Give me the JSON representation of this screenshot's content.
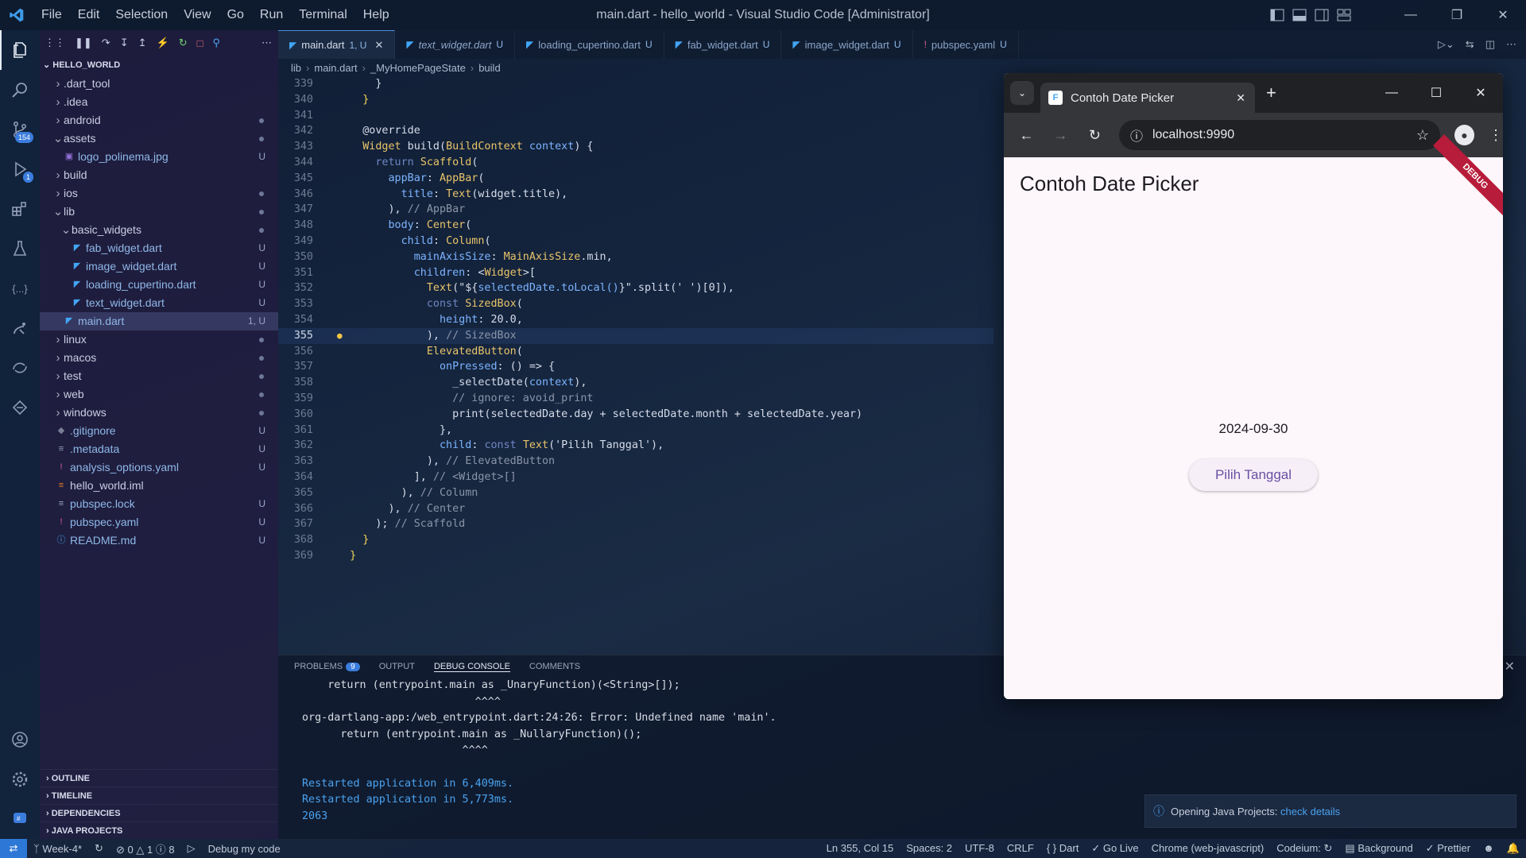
{
  "titlebar": {
    "menu": [
      "File",
      "Edit",
      "Selection",
      "View",
      "Go",
      "Run",
      "Terminal",
      "Help"
    ],
    "title": "main.dart - hello_world - Visual Studio Code [Administrator]"
  },
  "activity": {
    "scm_badge": "154",
    "debug_badge": "1"
  },
  "sidebar": {
    "header": "HELLO_WORLD",
    "tree": [
      {
        "label": ".dart_tool",
        "type": "folder",
        "depth": 0,
        "status": ""
      },
      {
        "label": ".idea",
        "type": "folder",
        "depth": 0,
        "status": ""
      },
      {
        "label": "android",
        "type": "folder",
        "depth": 0,
        "status": "dot"
      },
      {
        "label": "assets",
        "type": "folder-open",
        "depth": 0,
        "status": "dot"
      },
      {
        "label": "logo_polinema.jpg",
        "type": "image",
        "depth": 1,
        "status": "U"
      },
      {
        "label": "build",
        "type": "folder",
        "depth": 0,
        "status": ""
      },
      {
        "label": "ios",
        "type": "folder",
        "depth": 0,
        "status": "dot"
      },
      {
        "label": "lib",
        "type": "folder-open",
        "depth": 0,
        "status": "dot"
      },
      {
        "label": "basic_widgets",
        "type": "folder-open",
        "depth": 1,
        "status": "dot"
      },
      {
        "label": "fab_widget.dart",
        "type": "dart",
        "depth": 2,
        "status": "U"
      },
      {
        "label": "image_widget.dart",
        "type": "dart",
        "depth": 2,
        "status": "U"
      },
      {
        "label": "loading_cupertino.dart",
        "type": "dart",
        "depth": 2,
        "status": "U"
      },
      {
        "label": "text_widget.dart",
        "type": "dart",
        "depth": 2,
        "status": "U"
      },
      {
        "label": "main.dart",
        "type": "dart",
        "depth": 1,
        "status": "1, U",
        "selected": true
      },
      {
        "label": "linux",
        "type": "folder",
        "depth": 0,
        "status": "dot"
      },
      {
        "label": "macos",
        "type": "folder",
        "depth": 0,
        "status": "dot"
      },
      {
        "label": "test",
        "type": "folder",
        "depth": 0,
        "status": "dot"
      },
      {
        "label": "web",
        "type": "folder",
        "depth": 0,
        "status": "dot"
      },
      {
        "label": "windows",
        "type": "folder",
        "depth": 0,
        "status": "dot"
      },
      {
        "label": ".gitignore",
        "type": "git",
        "depth": 0,
        "status": "U"
      },
      {
        "label": ".metadata",
        "type": "text",
        "depth": 0,
        "status": "U"
      },
      {
        "label": "analysis_options.yaml",
        "type": "yaml",
        "depth": 0,
        "status": "U"
      },
      {
        "label": "hello_world.iml",
        "type": "xml",
        "depth": 0,
        "status": ""
      },
      {
        "label": "pubspec.lock",
        "type": "text",
        "depth": 0,
        "status": "U"
      },
      {
        "label": "pubspec.yaml",
        "type": "yaml",
        "depth": 0,
        "status": "U"
      },
      {
        "label": "README.md",
        "type": "info",
        "depth": 0,
        "status": "U"
      }
    ],
    "sections": [
      "OUTLINE",
      "TIMELINE",
      "DEPENDENCIES",
      "JAVA PROJECTS"
    ]
  },
  "tabs": [
    {
      "label": "main.dart",
      "status": "1, U",
      "active": true,
      "icon": "dart",
      "closable": true
    },
    {
      "label": "text_widget.dart",
      "status": "U",
      "active": false,
      "icon": "dart",
      "italic": true
    },
    {
      "label": "loading_cupertino.dart",
      "status": "U",
      "active": false,
      "icon": "dart"
    },
    {
      "label": "fab_widget.dart",
      "status": "U",
      "active": false,
      "icon": "dart"
    },
    {
      "label": "image_widget.dart",
      "status": "U",
      "active": false,
      "icon": "dart"
    },
    {
      "label": "pubspec.yaml",
      "status": "U",
      "active": false,
      "icon": "yaml"
    }
  ],
  "breadcrumb": [
    "lib",
    "main.dart",
    "_MyHomePageState",
    "build"
  ],
  "code": {
    "current_line": 355,
    "lines": [
      {
        "n": 339,
        "tokens": [
          {
            "t": "      }",
            "c": "#d6dcea"
          }
        ]
      },
      {
        "n": 340,
        "tokens": [
          {
            "t": "    }",
            "c": "#f2d55c"
          }
        ]
      },
      {
        "n": 341,
        "tokens": []
      },
      {
        "n": 342,
        "tokens": [
          {
            "t": "    @override",
            "c": "#d6dcea"
          }
        ]
      },
      {
        "n": 343,
        "tokens": [
          {
            "t": "    Widget",
            "c": "#e9c46a"
          },
          {
            "t": " build(",
            "c": "#d6dcea"
          },
          {
            "t": "BuildContext",
            "c": "#e9c46a"
          },
          {
            "t": " context",
            "c": "#7cb4ff"
          },
          {
            "t": ") {",
            "c": "#d6dcea"
          }
        ]
      },
      {
        "n": 344,
        "tokens": [
          {
            "t": "      return ",
            "c": "#6f86c4"
          },
          {
            "t": "Scaffold",
            "c": "#e9c46a"
          },
          {
            "t": "(",
            "c": "#d6dcea"
          }
        ]
      },
      {
        "n": 345,
        "tokens": [
          {
            "t": "        appBar",
            "c": "#7cb4ff"
          },
          {
            "t": ": ",
            "c": "#d6dcea"
          },
          {
            "t": "AppBar",
            "c": "#e9c46a"
          },
          {
            "t": "(",
            "c": "#d6dcea"
          }
        ]
      },
      {
        "n": 346,
        "tokens": [
          {
            "t": "          title",
            "c": "#7cb4ff"
          },
          {
            "t": ": ",
            "c": "#d6dcea"
          },
          {
            "t": "Text",
            "c": "#e9c46a"
          },
          {
            "t": "(widget.title),",
            "c": "#d6dcea"
          }
        ]
      },
      {
        "n": 347,
        "tokens": [
          {
            "t": "        ), ",
            "c": "#d6dcea"
          },
          {
            "t": "// AppBar",
            "c": "#8b95a8"
          }
        ]
      },
      {
        "n": 348,
        "tokens": [
          {
            "t": "        body",
            "c": "#7cb4ff"
          },
          {
            "t": ": ",
            "c": "#d6dcea"
          },
          {
            "t": "Center",
            "c": "#e9c46a"
          },
          {
            "t": "(",
            "c": "#d6dcea"
          }
        ]
      },
      {
        "n": 349,
        "tokens": [
          {
            "t": "          child",
            "c": "#7cb4ff"
          },
          {
            "t": ": ",
            "c": "#d6dcea"
          },
          {
            "t": "Column",
            "c": "#e9c46a"
          },
          {
            "t": "(",
            "c": "#d6dcea"
          }
        ]
      },
      {
        "n": 350,
        "tokens": [
          {
            "t": "            mainAxisSize",
            "c": "#7cb4ff"
          },
          {
            "t": ": ",
            "c": "#d6dcea"
          },
          {
            "t": "MainAxisSize",
            "c": "#e9c46a"
          },
          {
            "t": ".min,",
            "c": "#d6dcea"
          }
        ]
      },
      {
        "n": 351,
        "tokens": [
          {
            "t": "            children",
            "c": "#7cb4ff"
          },
          {
            "t": ": <",
            "c": "#d6dcea"
          },
          {
            "t": "Widget",
            "c": "#e9c46a"
          },
          {
            "t": ">[",
            "c": "#d6dcea"
          }
        ]
      },
      {
        "n": 352,
        "tokens": [
          {
            "t": "              Text",
            "c": "#e9c46a"
          },
          {
            "t": "(\"${",
            "c": "#d6dcea"
          },
          {
            "t": "selectedDate.toLocal()",
            "c": "#7cb4ff"
          },
          {
            "t": "}\".split(' ')[0]),",
            "c": "#d6dcea"
          }
        ]
      },
      {
        "n": 353,
        "tokens": [
          {
            "t": "              const ",
            "c": "#6f86c4"
          },
          {
            "t": "SizedBox",
            "c": "#e9c46a"
          },
          {
            "t": "(",
            "c": "#d6dcea"
          }
        ]
      },
      {
        "n": 354,
        "tokens": [
          {
            "t": "                height",
            "c": "#7cb4ff"
          },
          {
            "t": ": 20.0,",
            "c": "#d6dcea"
          }
        ]
      },
      {
        "n": 355,
        "tokens": [
          {
            "t": "              ), ",
            "c": "#d6dcea"
          },
          {
            "t": "// SizedBox",
            "c": "#8b95a8"
          }
        ]
      },
      {
        "n": 356,
        "tokens": [
          {
            "t": "              ElevatedButton",
            "c": "#e9c46a"
          },
          {
            "t": "(",
            "c": "#d6dcea"
          }
        ]
      },
      {
        "n": 357,
        "tokens": [
          {
            "t": "                onPressed",
            "c": "#7cb4ff"
          },
          {
            "t": ": () => {",
            "c": "#d6dcea"
          }
        ]
      },
      {
        "n": 358,
        "tokens": [
          {
            "t": "                  _selectDate(",
            "c": "#d6dcea"
          },
          {
            "t": "context",
            "c": "#7cb4ff"
          },
          {
            "t": "),",
            "c": "#d6dcea"
          }
        ]
      },
      {
        "n": 359,
        "tokens": [
          {
            "t": "                  // ignore: avoid_print",
            "c": "#8b95a8"
          }
        ]
      },
      {
        "n": 360,
        "tokens": [
          {
            "t": "                  print(selectedDate.day + selectedDate.month + selectedDate.year)",
            "c": "#d6dcea"
          }
        ]
      },
      {
        "n": 361,
        "tokens": [
          {
            "t": "                },",
            "c": "#d6dcea"
          }
        ]
      },
      {
        "n": 362,
        "tokens": [
          {
            "t": "                child",
            "c": "#7cb4ff"
          },
          {
            "t": ": ",
            "c": "#d6dcea"
          },
          {
            "t": "const ",
            "c": "#6f86c4"
          },
          {
            "t": "Text",
            "c": "#e9c46a"
          },
          {
            "t": "('Pilih Tanggal'),",
            "c": "#d6dcea"
          }
        ]
      },
      {
        "n": 363,
        "tokens": [
          {
            "t": "              ), ",
            "c": "#d6dcea"
          },
          {
            "t": "// ElevatedButton",
            "c": "#8b95a8"
          }
        ]
      },
      {
        "n": 364,
        "tokens": [
          {
            "t": "            ], ",
            "c": "#d6dcea"
          },
          {
            "t": "// <Widget>[]",
            "c": "#8b95a8"
          }
        ]
      },
      {
        "n": 365,
        "tokens": [
          {
            "t": "          ), ",
            "c": "#d6dcea"
          },
          {
            "t": "// Column",
            "c": "#8b95a8"
          }
        ]
      },
      {
        "n": 366,
        "tokens": [
          {
            "t": "        ), ",
            "c": "#d6dcea"
          },
          {
            "t": "// Center",
            "c": "#8b95a8"
          }
        ]
      },
      {
        "n": 367,
        "tokens": [
          {
            "t": "      ); ",
            "c": "#d6dcea"
          },
          {
            "t": "// Scaffold",
            "c": "#8b95a8"
          }
        ]
      },
      {
        "n": 368,
        "tokens": [
          {
            "t": "    }",
            "c": "#f2d55c"
          }
        ]
      },
      {
        "n": 369,
        "tokens": [
          {
            "t": "  }",
            "c": "#f2d55c"
          }
        ]
      }
    ]
  },
  "panel": {
    "tabs": [
      {
        "label": "PROBLEMS",
        "badge": "9"
      },
      {
        "label": "OUTPUT"
      },
      {
        "label": "DEBUG CONSOLE",
        "active": true
      },
      {
        "label": "COMMENTS"
      }
    ],
    "console": [
      {
        "text": "    return (entrypoint.main as _UnaryFunction)(<String>[]);",
        "kind": "err"
      },
      {
        "text": "                           ^^^^",
        "kind": "err"
      },
      {
        "text": "org-dartlang-app:/web_entrypoint.dart:24:26: Error: Undefined name 'main'.",
        "kind": "err"
      },
      {
        "text": "      return (entrypoint.main as _NullaryFunction)();",
        "kind": "err"
      },
      {
        "text": "                         ^^^^",
        "kind": "err"
      },
      {
        "text": "",
        "kind": "err"
      },
      {
        "text": "Restarted application in 6,409ms.",
        "kind": "info"
      },
      {
        "text": "Restarted application in 5,773ms.",
        "kind": "info"
      },
      {
        "text": "2063",
        "kind": "info"
      }
    ]
  },
  "notification": {
    "text": "Opening Java Projects: ",
    "link": "check details"
  },
  "statusbar": {
    "branch": "Week-4*",
    "errors": "0",
    "warnings": "1",
    "infos": "8",
    "debug": "Debug my code",
    "position": "Ln 355, Col 15",
    "spaces": "Spaces: 2",
    "encoding": "UTF-8",
    "eol": "CRLF",
    "language": "Dart",
    "golive": "Go Live",
    "device": "Chrome (web-javascript)",
    "codeium": "Codeium:",
    "background": "Background",
    "prettier": "Prettier"
  },
  "browser": {
    "tab_title": "Contoh Date Picker",
    "url": "localhost:9990",
    "app_title": "Contoh Date Picker",
    "debug_banner": "DEBUG",
    "date_text": "2024-09-30",
    "button_label": "Pilih Tanggal"
  },
  "colors": {
    "accent": "#3b7ddd",
    "flutter_primary": "#6750a4",
    "debug_ribbon": "#b71c3a"
  }
}
